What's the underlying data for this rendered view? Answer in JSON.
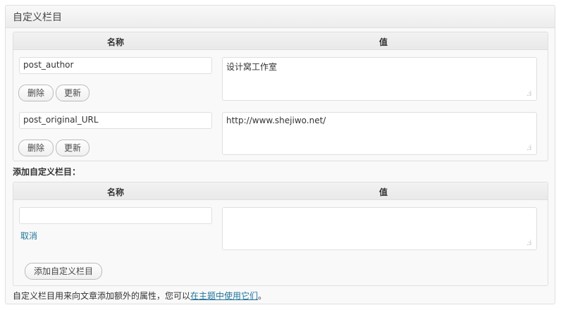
{
  "box": {
    "title": "自定义栏目"
  },
  "existing": {
    "col_name": "名称",
    "col_value": "值",
    "rows": [
      {
        "key": "post_author",
        "value": "设计窝工作室",
        "delete_label": "删除",
        "update_label": "更新"
      },
      {
        "key": "post_original_URL",
        "value": "http://www.shejiwo.net/",
        "delete_label": "删除",
        "update_label": "更新"
      }
    ]
  },
  "add_new": {
    "heading": "添加自定义栏目：",
    "col_name": "名称",
    "col_value": "值",
    "key_value": "",
    "value_value": "",
    "cancel_label": "取消",
    "submit_label": "添加自定义栏目"
  },
  "footer": {
    "text": "自定义栏目用来向文章添加额外的属性，您可以",
    "link": "在主题中使用它们",
    "suffix": "。"
  }
}
